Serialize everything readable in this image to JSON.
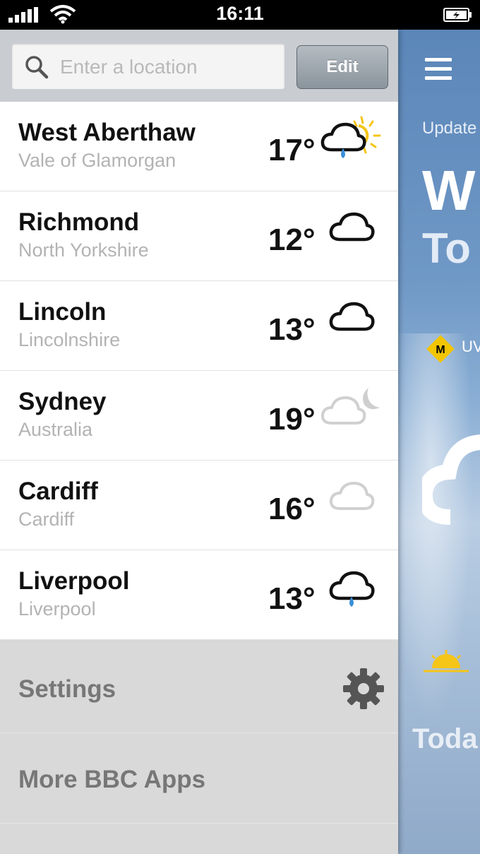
{
  "status": {
    "time": "16:11",
    "icons": [
      "signal-icon",
      "wifi-icon",
      "battery-charging-icon"
    ]
  },
  "search": {
    "placeholder": "Enter a location",
    "icon": "search-icon",
    "edit_label": "Edit"
  },
  "locations": [
    {
      "name": "West Aberthaw",
      "region": "Vale of Glamorgan",
      "temp": "17°",
      "icon": "light-rain-sunny-intervals-icon"
    },
    {
      "name": "Richmond",
      "region": "North Yorkshire",
      "temp": "12°",
      "icon": "cloud-icon"
    },
    {
      "name": "Lincoln",
      "region": "Lincolnshire",
      "temp": "13°",
      "icon": "cloud-icon"
    },
    {
      "name": "Sydney",
      "region": "Australia",
      "temp": "19°",
      "icon": "cloud-night-icon"
    },
    {
      "name": "Cardiff",
      "region": "Cardiff",
      "temp": "16°",
      "icon": "light-cloud-icon"
    },
    {
      "name": "Liverpool",
      "region": "Liverpool",
      "temp": "13°",
      "icon": "light-rain-icon"
    }
  ],
  "menu": {
    "settings_label": "Settings",
    "settings_icon": "gear-icon",
    "more_apps_label": "More BBC Apps"
  },
  "main_peek": {
    "updated": "Update",
    "title": "W",
    "subtitle": "To",
    "uv_badge": "M",
    "uv_label": "UV",
    "today_label": "Toda"
  },
  "colors": {
    "accent_blue": "#3a8fd8",
    "sun_yellow": "#f5c518",
    "uv_badge": "#f2c500"
  }
}
